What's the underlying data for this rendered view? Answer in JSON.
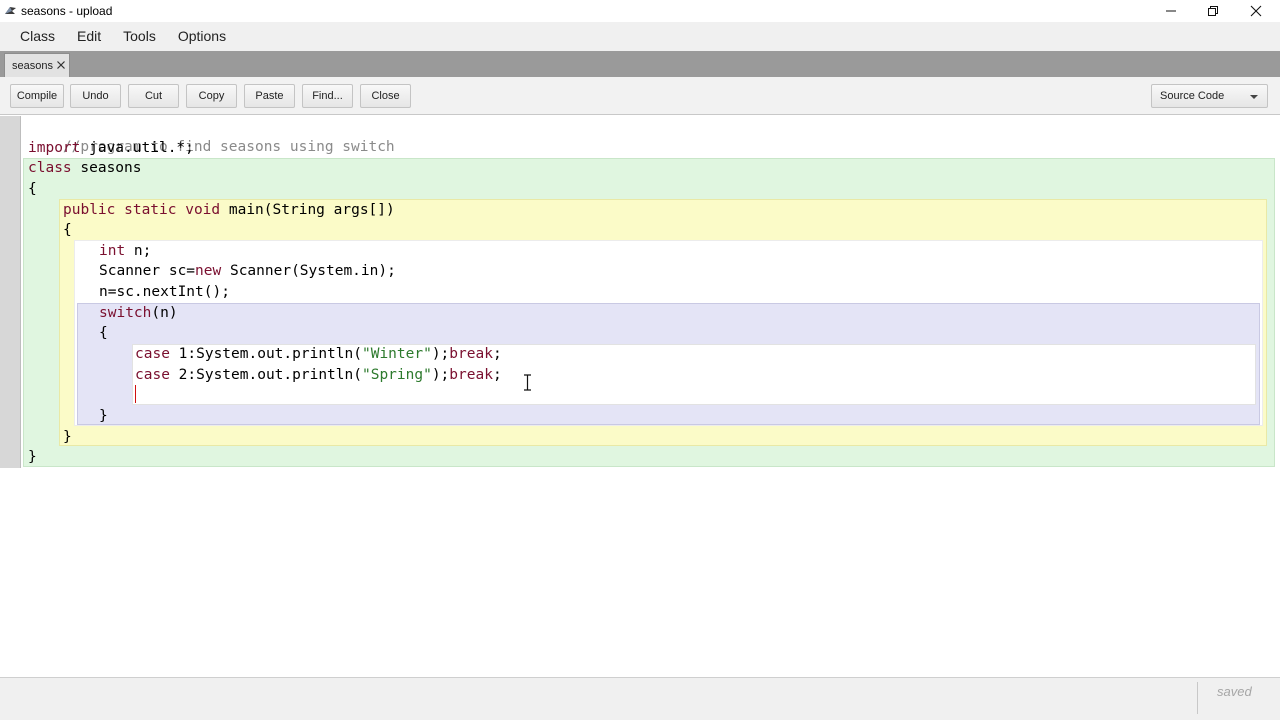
{
  "window": {
    "title": "seasons - upload"
  },
  "menu": [
    "Class",
    "Edit",
    "Tools",
    "Options"
  ],
  "tab": {
    "label": "seasons"
  },
  "toolbar": {
    "compile": "Compile",
    "undo": "Undo",
    "cut": "Cut",
    "copy": "Copy",
    "paste": "Paste",
    "find": "Find...",
    "close": "Close",
    "view_select": "Source Code"
  },
  "code": {
    "comment": "//program to find seasons using switch",
    "import_kw": "import",
    "import_rest": " java.util.*;",
    "class_kw": "class",
    "class_rest": " seasons",
    "open_brace_class": "{",
    "method_kw": "public static void",
    "method_rest": " main(String args[])",
    "open_brace_method": "{",
    "int_kw": "int",
    "int_rest": " n;",
    "scanner_a": "Scanner sc=",
    "new_kw": "new",
    "scanner_b": " Scanner(System.in);",
    "assign": "n=sc.nextInt();",
    "switch_kw": "switch",
    "switch_rest": "(n)",
    "open_brace_switch": "{",
    "case1_kw": "case",
    "case1_a": " 1:System.out.println(",
    "case1_str": "\"Winter\"",
    "case1_b": ");",
    "case1_break": "break",
    "case1_end": ";",
    "case2_kw": "case",
    "case2_a": " 2:System.out.println(",
    "case2_str": "\"Spring\"",
    "case2_b": ");",
    "case2_break": "break",
    "case2_end": ";",
    "close_brace_switch": "}",
    "close_brace_method": "}",
    "close_brace_class": "}"
  },
  "status": {
    "text": "saved"
  },
  "colors": {
    "keyword": "#7a0f2f",
    "comment": "#8a8a8a",
    "string": "#2d7a2d",
    "class_scope": "#e0f6e0",
    "method_scope": "#fbfbc8",
    "switch_scope": "#e4e4f6"
  }
}
